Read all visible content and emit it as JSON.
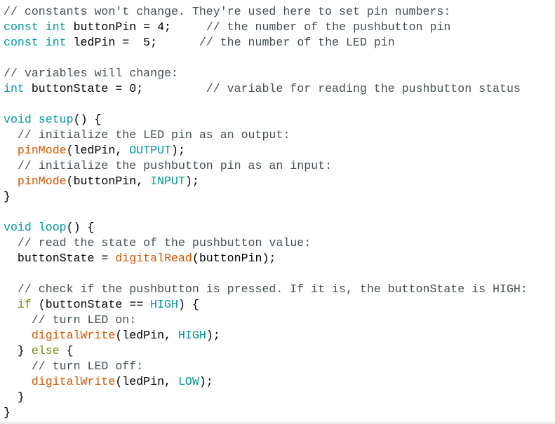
{
  "colors": {
    "comment": "#434f54",
    "keyword": "#00979c",
    "function": "#d35400",
    "control": "#728e00",
    "plain": "#000000"
  },
  "code_lines": [
    [
      [
        "c",
        "// constants won't change. They're used here to set pin numbers:"
      ]
    ],
    [
      [
        "k",
        "const"
      ],
      [
        "p",
        " "
      ],
      [
        "k",
        "int"
      ],
      [
        "p",
        " buttonPin = 4;     "
      ],
      [
        "c",
        "// the number of the pushbutton pin"
      ]
    ],
    [
      [
        "k",
        "const"
      ],
      [
        "p",
        " "
      ],
      [
        "k",
        "int"
      ],
      [
        "p",
        " ledPin =  5;      "
      ],
      [
        "c",
        "// the number of the LED pin"
      ]
    ],
    [],
    [
      [
        "c",
        "// variables will change:"
      ]
    ],
    [
      [
        "k",
        "int"
      ],
      [
        "p",
        " buttonState = 0;         "
      ],
      [
        "c",
        "// variable for reading the pushbutton status"
      ]
    ],
    [],
    [
      [
        "k",
        "void"
      ],
      [
        "p",
        " "
      ],
      [
        "k",
        "setup"
      ],
      [
        "p",
        "() {"
      ]
    ],
    [
      [
        "p",
        "  "
      ],
      [
        "c",
        "// initialize the LED pin as an output:"
      ]
    ],
    [
      [
        "p",
        "  "
      ],
      [
        "f",
        "pinMode"
      ],
      [
        "p",
        "(ledPin, "
      ],
      [
        "k",
        "OUTPUT"
      ],
      [
        "p",
        ");"
      ]
    ],
    [
      [
        "p",
        "  "
      ],
      [
        "c",
        "// initialize the pushbutton pin as an input:"
      ]
    ],
    [
      [
        "p",
        "  "
      ],
      [
        "f",
        "pinMode"
      ],
      [
        "p",
        "(buttonPin, "
      ],
      [
        "k",
        "INPUT"
      ],
      [
        "p",
        ");"
      ]
    ],
    [
      [
        "p",
        "}"
      ]
    ],
    [],
    [
      [
        "k",
        "void"
      ],
      [
        "p",
        " "
      ],
      [
        "k",
        "loop"
      ],
      [
        "p",
        "() {"
      ]
    ],
    [
      [
        "p",
        "  "
      ],
      [
        "c",
        "// read the state of the pushbutton value:"
      ]
    ],
    [
      [
        "p",
        "  buttonState = "
      ],
      [
        "f",
        "digitalRead"
      ],
      [
        "p",
        "(buttonPin);"
      ]
    ],
    [],
    [
      [
        "p",
        "  "
      ],
      [
        "c",
        "// check if the pushbutton is pressed. If it is, the buttonState is HIGH:"
      ]
    ],
    [
      [
        "p",
        "  "
      ],
      [
        "o",
        "if"
      ],
      [
        "p",
        " (buttonState == "
      ],
      [
        "k",
        "HIGH"
      ],
      [
        "p",
        ") {"
      ]
    ],
    [
      [
        "p",
        "    "
      ],
      [
        "c",
        "// turn LED on:"
      ]
    ],
    [
      [
        "p",
        "    "
      ],
      [
        "f",
        "digitalWrite"
      ],
      [
        "p",
        "(ledPin, "
      ],
      [
        "k",
        "HIGH"
      ],
      [
        "p",
        ");"
      ]
    ],
    [
      [
        "p",
        "  } "
      ],
      [
        "o",
        "else"
      ],
      [
        "p",
        " {"
      ]
    ],
    [
      [
        "p",
        "    "
      ],
      [
        "c",
        "// turn LED off:"
      ]
    ],
    [
      [
        "p",
        "    "
      ],
      [
        "f",
        "digitalWrite"
      ],
      [
        "p",
        "(ledPin, "
      ],
      [
        "k",
        "LOW"
      ],
      [
        "p",
        ");"
      ]
    ],
    [
      [
        "p",
        "  }"
      ]
    ],
    [
      [
        "p",
        "}"
      ]
    ]
  ]
}
